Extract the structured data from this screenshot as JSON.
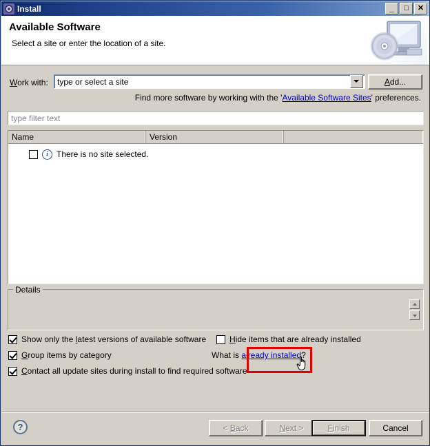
{
  "window": {
    "title": "Install",
    "icon": "gear-icon",
    "controls": {
      "minimize": "_",
      "maximize": "□",
      "close": "✕"
    }
  },
  "banner": {
    "title": "Available Software",
    "subtitle": "Select a site or enter the location of a site.",
    "image": "monitor-with-disc-icon"
  },
  "form": {
    "work_with_label": "Work with:",
    "work_with_mnemonic": "W",
    "work_with_value": "type or select a site",
    "dropdown_icon": "chevron-down-icon",
    "add_button": "Add...",
    "add_mnemonic": "A",
    "hint_prefix": "Find more software by working with the '",
    "hint_link": "Available Software Sites",
    "hint_suffix": "' preferences.",
    "filter_placeholder": "type filter text"
  },
  "table": {
    "columns": [
      "Name",
      "Version",
      ""
    ],
    "rows": [
      {
        "checked": false,
        "icon": "info-icon",
        "label": "There is no site selected."
      }
    ]
  },
  "details": {
    "legend": "Details",
    "content": "",
    "scroll_up_icon": "scroll-up-icon",
    "scroll_down_icon": "scroll-down-icon"
  },
  "options": [
    {
      "id": "show-latest-versions",
      "label_before": "Show only the ",
      "mnemonic": "l",
      "label_after": "atest versions of available software",
      "checked": true
    },
    {
      "id": "group-by-category",
      "label_before": "",
      "mnemonic": "G",
      "label_after": "roup items by category",
      "checked": true
    },
    {
      "id": "contact-all-update-sites",
      "label_before": "",
      "mnemonic": "C",
      "label_after": "ontact all update sites during install to find required software",
      "checked": true
    },
    {
      "id": "hide-already-installed",
      "label_before": "",
      "mnemonic": "H",
      "label_after": "ide items that are already installed",
      "checked": false
    }
  ],
  "what_is": {
    "prefix": "What is ",
    "link": "already installed",
    "suffix": "?"
  },
  "footer": {
    "help_icon": "question-mark-icon",
    "back": "< Back",
    "back_mnemonic": "B",
    "next": "Next >",
    "next_mnemonic": "N",
    "finish": "Finish",
    "finish_mnemonic": "F",
    "cancel": "Cancel"
  },
  "annotation": {
    "highlight_color": "#e00000",
    "cursor": "pointing-hand-cursor"
  },
  "colors": {
    "title_bar_start": "#0f2a6b",
    "title_bar_end": "#b9cbe6",
    "dialog_background": "#d4d0c8",
    "link": "#0000c0",
    "info_icon": "#2b5797"
  }
}
